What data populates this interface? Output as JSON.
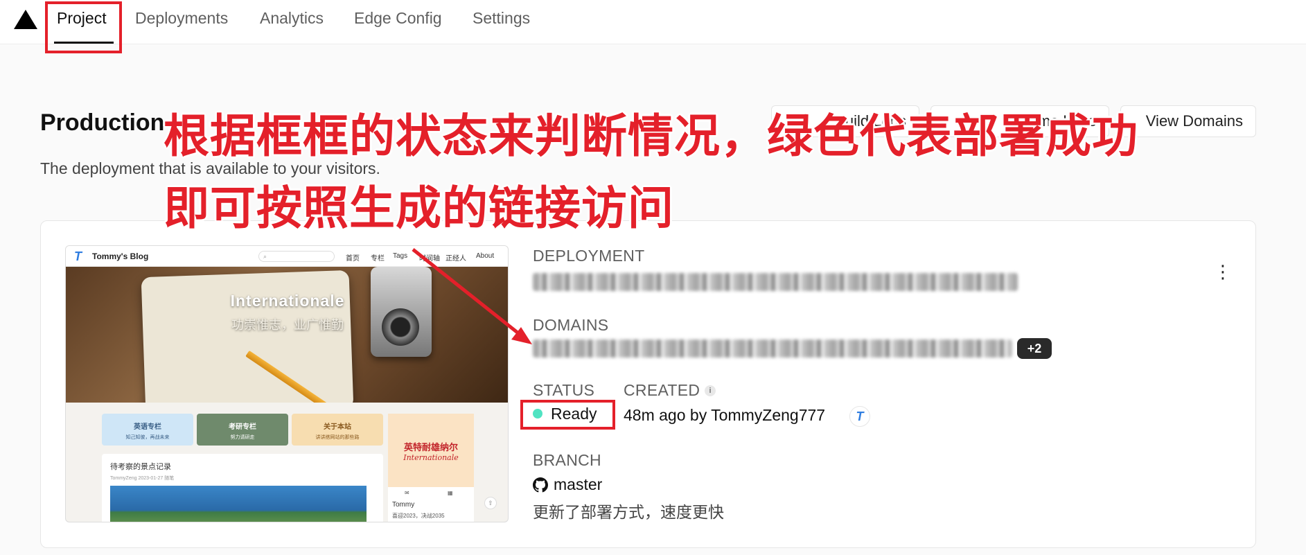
{
  "nav": {
    "tabs": [
      {
        "label": "Project",
        "active": true
      },
      {
        "label": "Deployments"
      },
      {
        "label": "Analytics"
      },
      {
        "label": "Edge Config"
      },
      {
        "label": "Settings"
      }
    ]
  },
  "header": {
    "title": "Production",
    "subtitle": "The deployment that is available to your visitors.",
    "buttons": {
      "build_logs": "Build Logs",
      "runtime_logs": "Runtime Logs",
      "view_domains": "View Domains"
    }
  },
  "preview": {
    "site_name": "Tommy's Blog",
    "menu": [
      "首页",
      "专栏",
      "Tags",
      "时间轴",
      "正经人",
      "About"
    ],
    "hero_title": "Internationale",
    "hero_subtitle": "功崇惟志，业广惟勤",
    "tiles": [
      {
        "title": "英语专栏",
        "sub": "知己知彼，再战未来"
      },
      {
        "title": "考研专栏",
        "sub": "努力请研走"
      },
      {
        "title": "关于本站",
        "sub": "讲讲搭网站的那些路"
      }
    ],
    "post_title": "待考察的景点记录",
    "post_meta": "TommyZeng  2023-01-27  随笔",
    "side_calligraphy": "英特耐雄纳尔",
    "side_calligraphy_latin": "Internationale",
    "side_name": "Tommy",
    "side_quote": "喜迎2023，决战2035"
  },
  "details": {
    "deployment_label": "DEPLOYMENT",
    "domains_label": "DOMAINS",
    "domains_more": "+2",
    "status_label": "STATUS",
    "status_value": "Ready",
    "status_color": "#50e3c2",
    "created_label": "CREATED",
    "created_value": "48m ago by TommyZeng777",
    "branch_label": "BRANCH",
    "branch_value": "master",
    "commit_message": "更新了部署方式，速度更快"
  },
  "annotations": {
    "line1": "根据框框的状态来判断情况，绿色代表部署成功",
    "line2": "即可按照生成的链接访问",
    "color": "#e4202a"
  }
}
